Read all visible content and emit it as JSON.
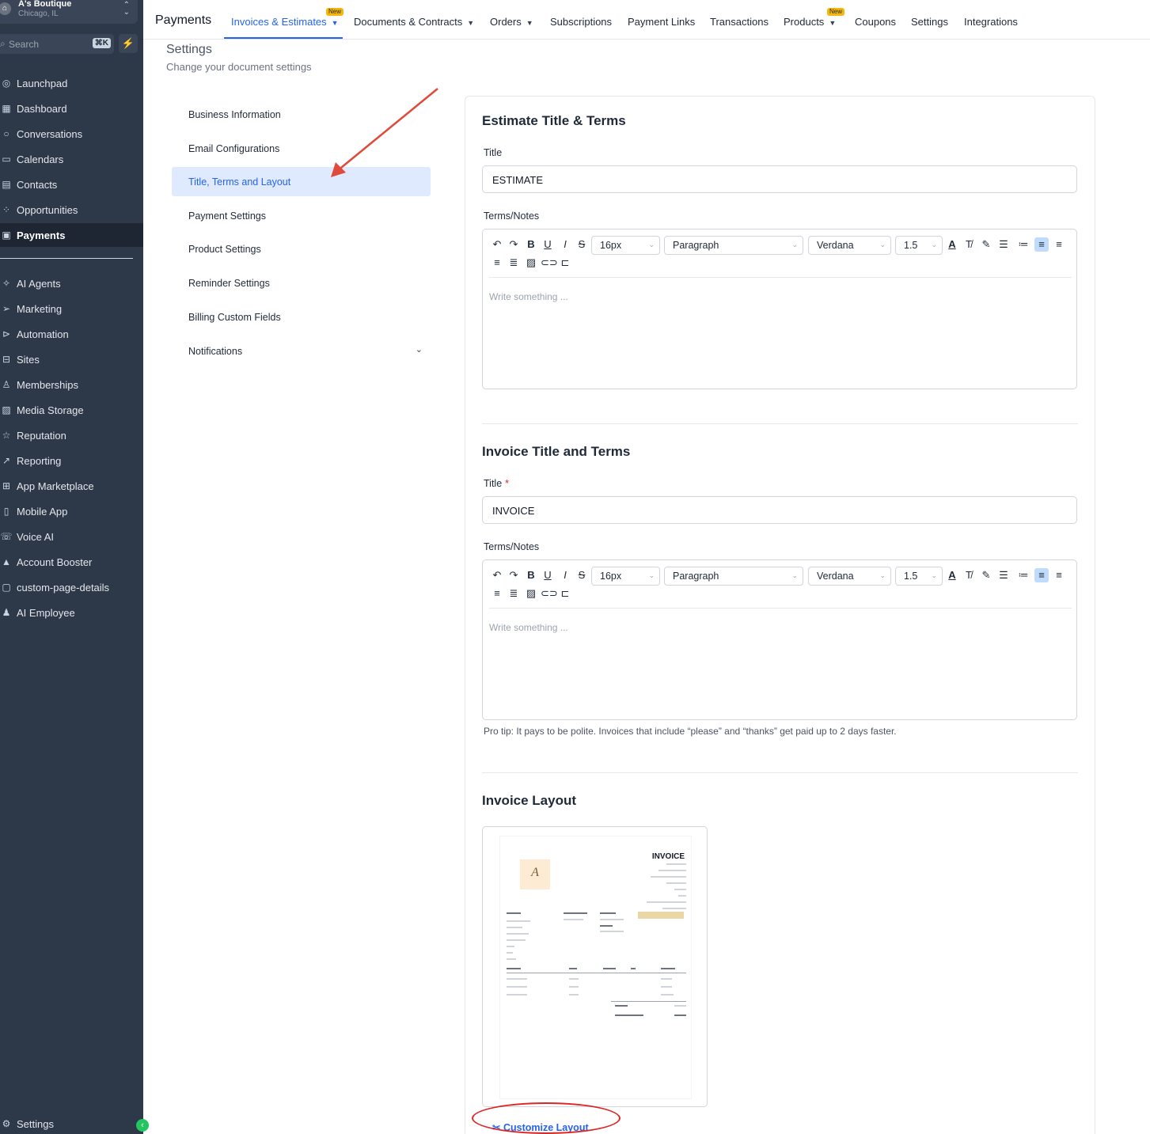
{
  "location": {
    "name": "A's Boutique",
    "city": "Chicago, IL"
  },
  "search": {
    "placeholder": "Search",
    "shortcut": "⌘K"
  },
  "sidebar": {
    "items": [
      {
        "label": "Launchpad",
        "icon": "rocket-icon"
      },
      {
        "label": "Dashboard",
        "icon": "grid-icon"
      },
      {
        "label": "Conversations",
        "icon": "chat-icon"
      },
      {
        "label": "Calendars",
        "icon": "calendar-icon"
      },
      {
        "label": "Contacts",
        "icon": "contacts-icon"
      },
      {
        "label": "Opportunities",
        "icon": "funnel-icon"
      },
      {
        "label": "Payments",
        "icon": "payments-icon"
      },
      {
        "label": "AI Agents",
        "icon": "sparkle-icon"
      },
      {
        "label": "Marketing",
        "icon": "send-icon"
      },
      {
        "label": "Automation",
        "icon": "automation-icon"
      },
      {
        "label": "Sites",
        "icon": "sites-icon"
      },
      {
        "label": "Memberships",
        "icon": "badge-icon"
      },
      {
        "label": "Media Storage",
        "icon": "image-icon"
      },
      {
        "label": "Reputation",
        "icon": "star-icon"
      },
      {
        "label": "Reporting",
        "icon": "trend-icon"
      },
      {
        "label": "App Marketplace",
        "icon": "apps-icon"
      },
      {
        "label": "Mobile App",
        "icon": "phone-icon"
      },
      {
        "label": "Voice AI",
        "icon": "voice-icon"
      },
      {
        "label": "Account Booster",
        "icon": "booster-icon"
      },
      {
        "label": "custom-page-details",
        "icon": "page-icon"
      },
      {
        "label": "AI Employee",
        "icon": "person-icon"
      }
    ],
    "settings_label": "Settings"
  },
  "topnav": {
    "brand": "Payments",
    "tabs": [
      {
        "label": "Invoices & Estimates",
        "badge": "New"
      },
      {
        "label": "Documents & Contracts"
      },
      {
        "label": "Orders"
      },
      {
        "label": "Subscriptions"
      },
      {
        "label": "Payment Links"
      },
      {
        "label": "Transactions"
      },
      {
        "label": "Products",
        "badge": "New"
      },
      {
        "label": "Coupons"
      },
      {
        "label": "Settings"
      },
      {
        "label": "Integrations"
      }
    ]
  },
  "page": {
    "title": "Settings",
    "subtitle": "Change your document settings"
  },
  "settings_nav": [
    "Business Information",
    "Email Configurations",
    "Title, Terms and Layout",
    "Payment Settings",
    "Product Settings",
    "Reminder Settings",
    "Billing Custom Fields",
    "Notifications"
  ],
  "estimate": {
    "heading": "Estimate Title & Terms",
    "title_label": "Title",
    "title_value": "ESTIMATE",
    "terms_label": "Terms/Notes",
    "placeholder": "Write something ..."
  },
  "invoice": {
    "heading": "Invoice Title and Terms",
    "title_label": "Title",
    "required_mark": "*",
    "title_value": "INVOICE",
    "terms_label": "Terms/Notes",
    "placeholder": "Write something ...",
    "tip": "Pro tip: It pays to be polite. Invoices that include “please” and “thanks” get paid up to 2 days faster."
  },
  "editor_toolbar": {
    "font_size": "16px",
    "block": "Paragraph",
    "font": "Verdana",
    "line_height": "1.5"
  },
  "layout": {
    "heading": "Invoice Layout",
    "preview_title": "INVOICE",
    "customize_label": "Customize Layout"
  },
  "colors": {
    "accent": "#2563eb",
    "sidebar": "#2d3849",
    "badge": "#f5b70a",
    "annotation": "#dc2626"
  }
}
